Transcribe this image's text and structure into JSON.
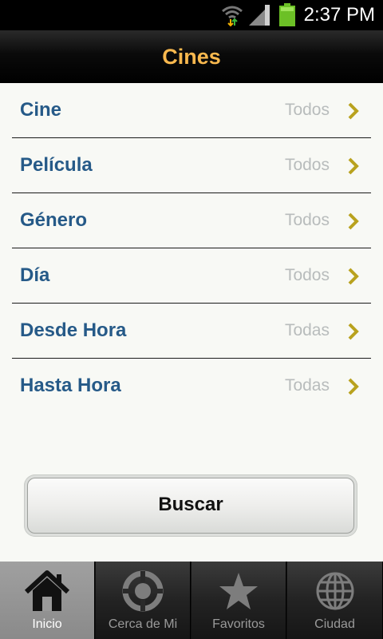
{
  "status_bar": {
    "time": "2:37 PM"
  },
  "header": {
    "title": "Cines"
  },
  "filters": [
    {
      "label": "Cine",
      "value": "Todos"
    },
    {
      "label": "Película",
      "value": "Todos"
    },
    {
      "label": "Género",
      "value": "Todos"
    },
    {
      "label": "Día",
      "value": "Todos"
    },
    {
      "label": "Desde Hora",
      "value": "Todas"
    },
    {
      "label": "Hasta Hora",
      "value": "Todas"
    }
  ],
  "search_button": {
    "label": "Buscar"
  },
  "tabs": [
    {
      "label": "Inicio",
      "icon": "home-icon",
      "active": true
    },
    {
      "label": "Cerca de Mi",
      "icon": "crosshair-icon",
      "active": false
    },
    {
      "label": "Favoritos",
      "icon": "star-icon",
      "active": false
    },
    {
      "label": "Ciudad",
      "icon": "globe-icon",
      "active": false
    }
  ],
  "colors": {
    "title": "#f8b84e",
    "label": "#265a88",
    "value": "#b8bcbc",
    "chevron": "#b9a21e"
  }
}
